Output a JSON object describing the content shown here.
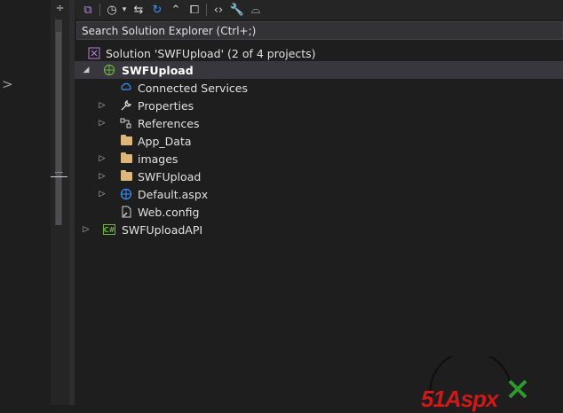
{
  "left_pane": {
    "collapse_glyph": ">"
  },
  "gutter": {
    "top_glyph": "÷"
  },
  "toolbar": {
    "buttons": [
      {
        "icon": "vs-switch-views-icon",
        "glyph": "⧉"
      },
      {
        "icon": "pending-changes-filter-icon",
        "glyph": "◷"
      },
      {
        "icon": "dropdown-chevron-icon",
        "glyph": "▾"
      },
      {
        "icon": "sync-with-active-document-icon",
        "glyph": "⇆"
      },
      {
        "icon": "refresh-icon",
        "glyph": "↻"
      },
      {
        "icon": "collapse-all-icon",
        "glyph": "⌃"
      },
      {
        "icon": "show-all-files-icon",
        "glyph": "⧠"
      },
      {
        "icon": "view-code-icon",
        "glyph": "‹›"
      },
      {
        "icon": "properties-wrench-icon",
        "glyph": "🔧"
      },
      {
        "icon": "preview-selected-items-icon",
        "glyph": "⌓"
      }
    ]
  },
  "search": {
    "placeholder": "Search Solution Explorer (Ctrl+;)"
  },
  "tree": [
    {
      "label": "Solution 'SWFUpload' (2 of 4 projects)",
      "icon": "solution-icon",
      "arrow": "",
      "bold": false,
      "selected": false
    },
    {
      "label": "SWFUpload",
      "icon": "web-project-globe-icon",
      "arrow": "◢",
      "bold": true,
      "selected": true
    },
    {
      "label": "Connected Services",
      "icon": "connected-services-icon",
      "arrow": "",
      "bold": false,
      "selected": false
    },
    {
      "label": "Properties",
      "icon": "properties-wrench-icon",
      "arrow": "▷",
      "bold": false,
      "selected": false
    },
    {
      "label": "References",
      "icon": "references-icon",
      "arrow": "▷",
      "bold": false,
      "selected": false
    },
    {
      "label": "App_Data",
      "icon": "folder-icon",
      "arrow": "",
      "bold": false,
      "selected": false
    },
    {
      "label": "images",
      "icon": "folder-icon",
      "arrow": "▷",
      "bold": false,
      "selected": false
    },
    {
      "label": "SWFUpload",
      "icon": "folder-icon",
      "arrow": "▷",
      "bold": false,
      "selected": false
    },
    {
      "label": "Default.aspx",
      "icon": "web-page-globe-icon",
      "arrow": "▷",
      "bold": false,
      "selected": false
    },
    {
      "label": "Web.config",
      "icon": "config-file-icon",
      "arrow": "",
      "bold": false,
      "selected": false
    },
    {
      "label": "SWFUploadAPI",
      "icon": "csharp-project-icon",
      "arrow": "▷",
      "bold": false,
      "selected": false
    }
  ],
  "watermark": {
    "text": "51Aspx"
  }
}
